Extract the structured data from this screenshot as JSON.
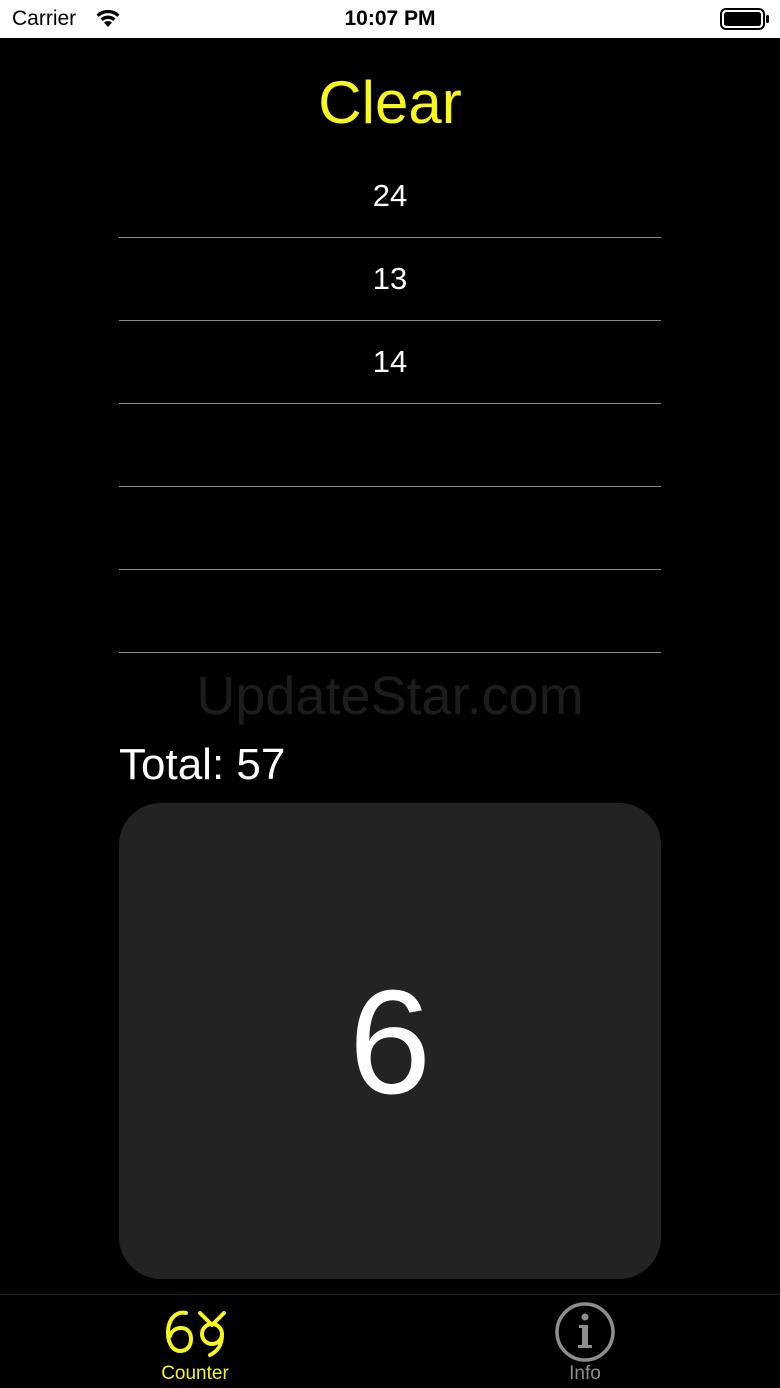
{
  "status_bar": {
    "carrier": "Carrier",
    "time": "10:07 PM"
  },
  "clear_label": "Clear",
  "history": [
    "24",
    "13",
    "14",
    "",
    "",
    ""
  ],
  "watermark": "UpdateStar.com",
  "total_text": "Total: 57",
  "counter_value": "6",
  "tab_bar": {
    "tabs": [
      {
        "label": "Counter",
        "icon": "counter-icon",
        "selected": true
      },
      {
        "label": "Info",
        "icon": "info-icon",
        "selected": false
      }
    ]
  },
  "colors": {
    "accent": "#f7f71a",
    "background": "#000000",
    "pad": "#232323",
    "inactive": "#8e8e8e"
  }
}
